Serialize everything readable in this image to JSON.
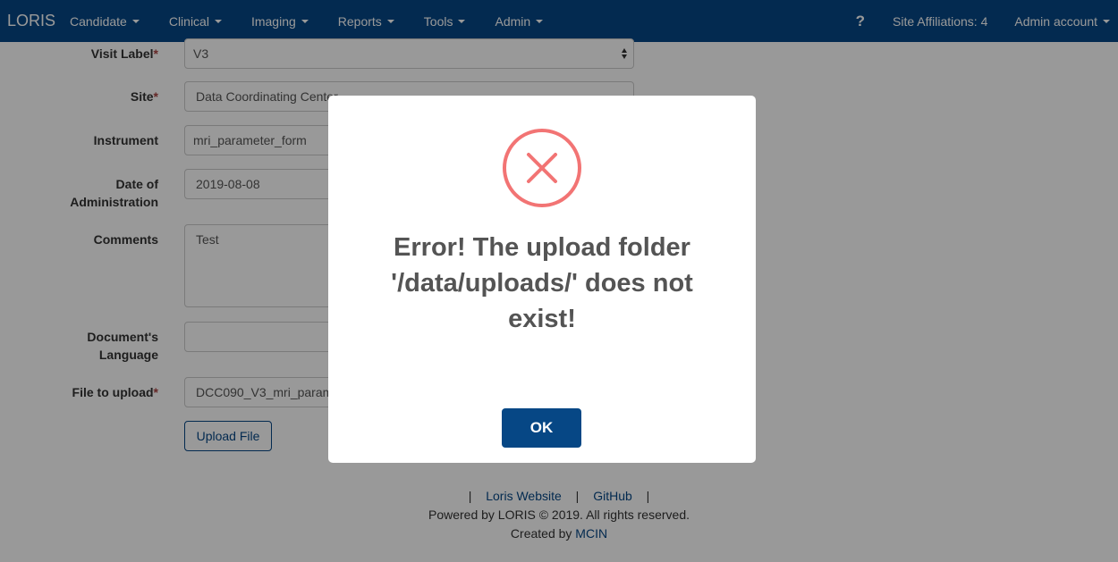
{
  "navbar": {
    "brand": "LORIS",
    "menus": [
      "Candidate",
      "Clinical",
      "Imaging",
      "Reports",
      "Tools",
      "Admin"
    ],
    "help": "?",
    "site_affiliations": "Site Affiliations: 4",
    "account": "Admin account"
  },
  "form": {
    "visit_label": {
      "label": "Visit Label",
      "required": "*",
      "value": "V3"
    },
    "site": {
      "label": "Site",
      "required": "*",
      "value": "Data Coordinating Center"
    },
    "instrument": {
      "label": "Instrument",
      "value": "mri_parameter_form"
    },
    "date": {
      "label_line1": "Date of",
      "label_line2": "Administration",
      "value": "2019-08-08"
    },
    "comments": {
      "label": "Comments",
      "value": "Test"
    },
    "language": {
      "label_line1": "Document's",
      "label_line2": "Language",
      "value": ""
    },
    "file": {
      "label": "File to upload",
      "required": "*",
      "value": "DCC090_V3_mri_parameter_form.pdf"
    },
    "upload_button": "Upload File"
  },
  "footer": {
    "pipe": "|",
    "loris_website": "Loris Website",
    "github": "GitHub",
    "powered": "Powered by LORIS © 2019. All rights reserved.",
    "created_by": "Created by",
    "mcin": "MCIN"
  },
  "modal": {
    "icon": "error-x-icon",
    "title": "Error! The upload folder '/data/uploads/' does not exist!",
    "ok_label": "OK"
  },
  "colors": {
    "navbar": "#064785",
    "error_icon": "#f27474",
    "primary_button": "#064785"
  }
}
